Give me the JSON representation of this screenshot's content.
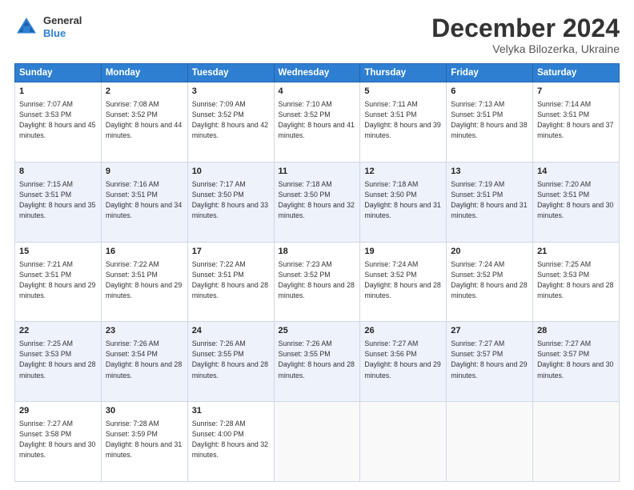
{
  "header": {
    "logo_general": "General",
    "logo_blue": "Blue",
    "month_title": "December 2024",
    "location": "Velyka Bilozerka, Ukraine"
  },
  "days_of_week": [
    "Sunday",
    "Monday",
    "Tuesday",
    "Wednesday",
    "Thursday",
    "Friday",
    "Saturday"
  ],
  "weeks": [
    [
      {
        "day": "1",
        "sunrise": "Sunrise: 7:07 AM",
        "sunset": "Sunset: 3:53 PM",
        "daylight": "Daylight: 8 hours and 45 minutes."
      },
      {
        "day": "2",
        "sunrise": "Sunrise: 7:08 AM",
        "sunset": "Sunset: 3:52 PM",
        "daylight": "Daylight: 8 hours and 44 minutes."
      },
      {
        "day": "3",
        "sunrise": "Sunrise: 7:09 AM",
        "sunset": "Sunset: 3:52 PM",
        "daylight": "Daylight: 8 hours and 42 minutes."
      },
      {
        "day": "4",
        "sunrise": "Sunrise: 7:10 AM",
        "sunset": "Sunset: 3:52 PM",
        "daylight": "Daylight: 8 hours and 41 minutes."
      },
      {
        "day": "5",
        "sunrise": "Sunrise: 7:11 AM",
        "sunset": "Sunset: 3:51 PM",
        "daylight": "Daylight: 8 hours and 39 minutes."
      },
      {
        "day": "6",
        "sunrise": "Sunrise: 7:13 AM",
        "sunset": "Sunset: 3:51 PM",
        "daylight": "Daylight: 8 hours and 38 minutes."
      },
      {
        "day": "7",
        "sunrise": "Sunrise: 7:14 AM",
        "sunset": "Sunset: 3:51 PM",
        "daylight": "Daylight: 8 hours and 37 minutes."
      }
    ],
    [
      {
        "day": "8",
        "sunrise": "Sunrise: 7:15 AM",
        "sunset": "Sunset: 3:51 PM",
        "daylight": "Daylight: 8 hours and 35 minutes."
      },
      {
        "day": "9",
        "sunrise": "Sunrise: 7:16 AM",
        "sunset": "Sunset: 3:51 PM",
        "daylight": "Daylight: 8 hours and 34 minutes."
      },
      {
        "day": "10",
        "sunrise": "Sunrise: 7:17 AM",
        "sunset": "Sunset: 3:50 PM",
        "daylight": "Daylight: 8 hours and 33 minutes."
      },
      {
        "day": "11",
        "sunrise": "Sunrise: 7:18 AM",
        "sunset": "Sunset: 3:50 PM",
        "daylight": "Daylight: 8 hours and 32 minutes."
      },
      {
        "day": "12",
        "sunrise": "Sunrise: 7:18 AM",
        "sunset": "Sunset: 3:50 PM",
        "daylight": "Daylight: 8 hours and 31 minutes."
      },
      {
        "day": "13",
        "sunrise": "Sunrise: 7:19 AM",
        "sunset": "Sunset: 3:51 PM",
        "daylight": "Daylight: 8 hours and 31 minutes."
      },
      {
        "day": "14",
        "sunrise": "Sunrise: 7:20 AM",
        "sunset": "Sunset: 3:51 PM",
        "daylight": "Daylight: 8 hours and 30 minutes."
      }
    ],
    [
      {
        "day": "15",
        "sunrise": "Sunrise: 7:21 AM",
        "sunset": "Sunset: 3:51 PM",
        "daylight": "Daylight: 8 hours and 29 minutes."
      },
      {
        "day": "16",
        "sunrise": "Sunrise: 7:22 AM",
        "sunset": "Sunset: 3:51 PM",
        "daylight": "Daylight: 8 hours and 29 minutes."
      },
      {
        "day": "17",
        "sunrise": "Sunrise: 7:22 AM",
        "sunset": "Sunset: 3:51 PM",
        "daylight": "Daylight: 8 hours and 28 minutes."
      },
      {
        "day": "18",
        "sunrise": "Sunrise: 7:23 AM",
        "sunset": "Sunset: 3:52 PM",
        "daylight": "Daylight: 8 hours and 28 minutes."
      },
      {
        "day": "19",
        "sunrise": "Sunrise: 7:24 AM",
        "sunset": "Sunset: 3:52 PM",
        "daylight": "Daylight: 8 hours and 28 minutes."
      },
      {
        "day": "20",
        "sunrise": "Sunrise: 7:24 AM",
        "sunset": "Sunset: 3:52 PM",
        "daylight": "Daylight: 8 hours and 28 minutes."
      },
      {
        "day": "21",
        "sunrise": "Sunrise: 7:25 AM",
        "sunset": "Sunset: 3:53 PM",
        "daylight": "Daylight: 8 hours and 28 minutes."
      }
    ],
    [
      {
        "day": "22",
        "sunrise": "Sunrise: 7:25 AM",
        "sunset": "Sunset: 3:53 PM",
        "daylight": "Daylight: 8 hours and 28 minutes."
      },
      {
        "day": "23",
        "sunrise": "Sunrise: 7:26 AM",
        "sunset": "Sunset: 3:54 PM",
        "daylight": "Daylight: 8 hours and 28 minutes."
      },
      {
        "day": "24",
        "sunrise": "Sunrise: 7:26 AM",
        "sunset": "Sunset: 3:55 PM",
        "daylight": "Daylight: 8 hours and 28 minutes."
      },
      {
        "day": "25",
        "sunrise": "Sunrise: 7:26 AM",
        "sunset": "Sunset: 3:55 PM",
        "daylight": "Daylight: 8 hours and 28 minutes."
      },
      {
        "day": "26",
        "sunrise": "Sunrise: 7:27 AM",
        "sunset": "Sunset: 3:56 PM",
        "daylight": "Daylight: 8 hours and 29 minutes."
      },
      {
        "day": "27",
        "sunrise": "Sunrise: 7:27 AM",
        "sunset": "Sunset: 3:57 PM",
        "daylight": "Daylight: 8 hours and 29 minutes."
      },
      {
        "day": "28",
        "sunrise": "Sunrise: 7:27 AM",
        "sunset": "Sunset: 3:57 PM",
        "daylight": "Daylight: 8 hours and 30 minutes."
      }
    ],
    [
      {
        "day": "29",
        "sunrise": "Sunrise: 7:27 AM",
        "sunset": "Sunset: 3:58 PM",
        "daylight": "Daylight: 8 hours and 30 minutes."
      },
      {
        "day": "30",
        "sunrise": "Sunrise: 7:28 AM",
        "sunset": "Sunset: 3:59 PM",
        "daylight": "Daylight: 8 hours and 31 minutes."
      },
      {
        "day": "31",
        "sunrise": "Sunrise: 7:28 AM",
        "sunset": "Sunset: 4:00 PM",
        "daylight": "Daylight: 8 hours and 32 minutes."
      },
      null,
      null,
      null,
      null
    ]
  ]
}
